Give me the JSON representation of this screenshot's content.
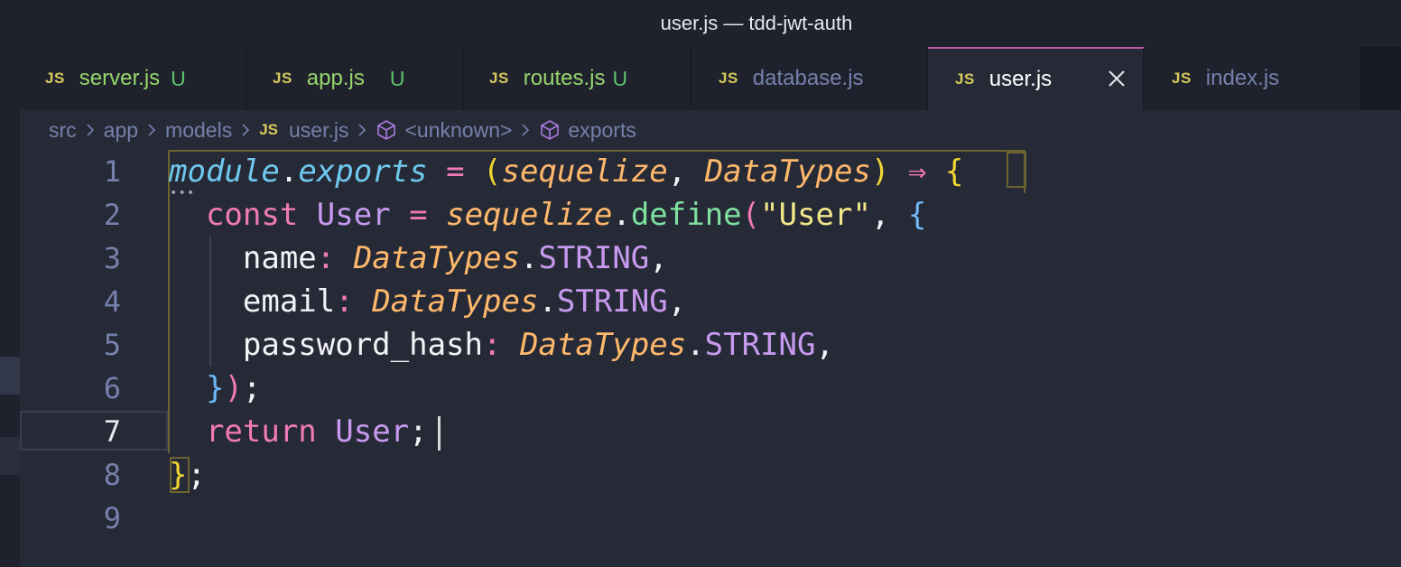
{
  "window": {
    "title": "user.js — tdd-jwt-auth"
  },
  "tabs": [
    {
      "icon": "JS",
      "label": "server.js",
      "status": "U"
    },
    {
      "icon": "JS",
      "label": "app.js",
      "status": "U"
    },
    {
      "icon": "JS",
      "label": "routes.js",
      "status": "U"
    },
    {
      "icon": "JS",
      "label": "database.js",
      "status": ""
    },
    {
      "icon": "JS",
      "label": "user.js",
      "status": "",
      "active": true
    },
    {
      "icon": "JS",
      "label": "index.js",
      "status": ""
    }
  ],
  "breadcrumb": [
    "src",
    "app",
    "models",
    "user.js",
    "<unknown>",
    "exports"
  ],
  "breadcrumb_icon": "JS",
  "editor": {
    "line_numbers": [
      "1",
      "2",
      "3",
      "4",
      "5",
      "6",
      "7",
      "8",
      "9"
    ],
    "current_line": "7",
    "code": {
      "l1": {
        "module": "module",
        "dot": ".",
        "exports": "exports",
        "eq": " = ",
        "open": "(",
        "sequelize": "sequelize",
        "comma": ", ",
        "datatypes": "DataTypes",
        "close": ")",
        "arrow": " ⇒ ",
        "brace": "{"
      },
      "l2": {
        "indent": "  ",
        "const": "const",
        "sp": " ",
        "user": "User",
        "eq": " = ",
        "sequelize": "sequelize",
        "dot": ".",
        "define": "define",
        "open": "(",
        "str": "\"User\"",
        "comma": ", ",
        "brace": "{"
      },
      "l3": {
        "indent": "    ",
        "key": "name",
        "colon": ": ",
        "dt": "DataTypes",
        "dot": ".",
        "type": "STRING",
        "comma": ","
      },
      "l4": {
        "indent": "    ",
        "key": "email",
        "colon": ": ",
        "dt": "DataTypes",
        "dot": ".",
        "type": "STRING",
        "comma": ","
      },
      "l5": {
        "indent": "    ",
        "key": "password_hash",
        "colon": ": ",
        "dt": "DataTypes",
        "dot": ".",
        "type": "STRING",
        "comma": ","
      },
      "l6": {
        "indent": "  ",
        "brace": "}",
        "paren": ")",
        "semi": ";"
      },
      "l7": {
        "indent": "  ",
        "ret": "return",
        "sp": " ",
        "user": "User",
        "semi": ";"
      },
      "l8": {
        "brace": "}",
        "semi": ";"
      }
    }
  },
  "colors": {
    "keyword": "#f07ab8",
    "variable": "#6fc9f0",
    "parameter": "#ffb86c",
    "function": "#7fe0a0",
    "constant": "#c79af0",
    "string": "#f1e88a",
    "bracket_l1": "#f1d633",
    "bracket_l2": "#6fb8f8",
    "untracked": "#5cc46c",
    "active_tab_border": "#c05aa3"
  }
}
